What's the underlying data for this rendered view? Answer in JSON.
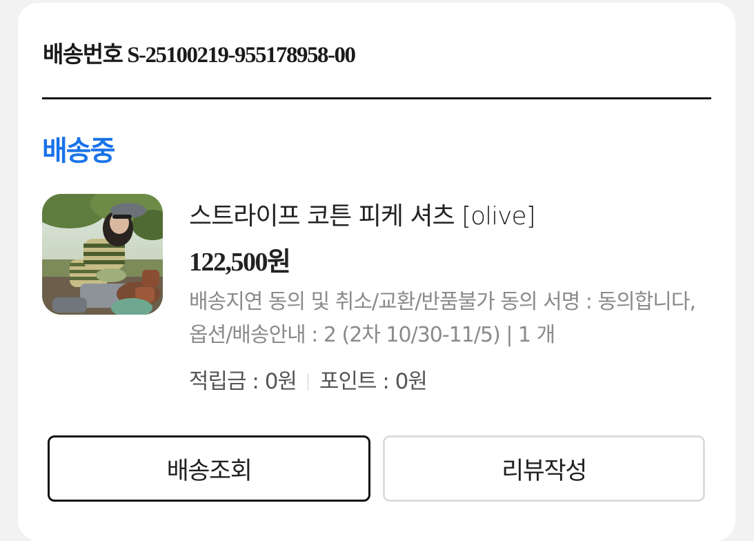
{
  "shipment": {
    "label": "배송번호 S-25100219-955178958-00"
  },
  "status": {
    "text": "배송중",
    "color": "#1a73e8"
  },
  "product": {
    "image": "product-photo",
    "name": "스트라이프 코튼 피케 셔츠 [olive]",
    "price": "122,500원",
    "options": "배송지연 동의 및 취소/교환/반품불가 동의 서명 : 동의합니다, 옵션/배송안내 : 2 (2차 10/30-11/5) | 1 개",
    "reserve": "적립금 : 0원",
    "points": "포인트 : 0원"
  },
  "actions": {
    "track_label": "배송조회",
    "review_label": "리뷰작성"
  }
}
